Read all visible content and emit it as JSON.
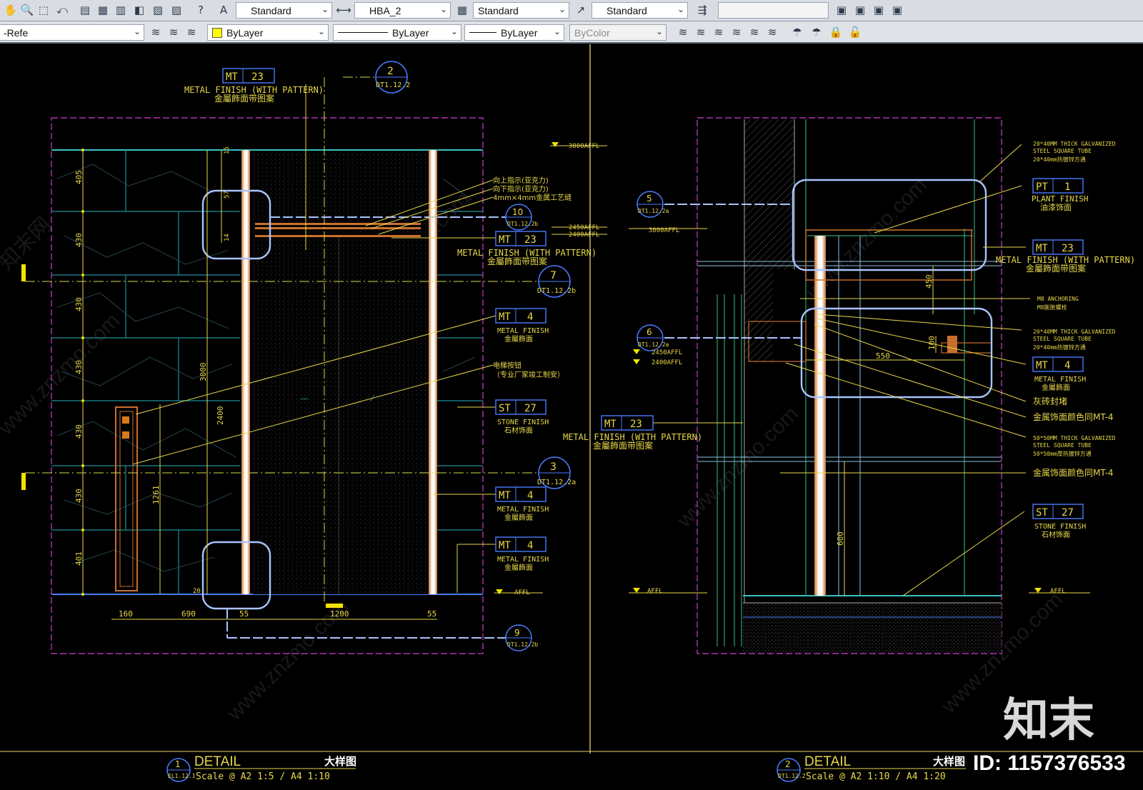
{
  "toolbar1": {
    "icons": [
      "pan-icon",
      "zoom-realtime-icon",
      "zoom-window-icon",
      "zoom-previous-icon",
      "save-icon",
      "properties-icon",
      "design-center-icon",
      "tool-palettes-icon",
      "sheet-set-icon",
      "markup-icon",
      "calculator-icon",
      "help-icon",
      "text-style-icon",
      "dim-style-icon",
      "table-style-icon",
      "multileader-style-icon",
      "layer-tools-icon",
      "view-add-icon",
      "view-2-icon",
      "view-3-icon",
      "view-4-icon"
    ],
    "text_style": "Standard",
    "dim_style": "HBA_2",
    "table_style": "Standard",
    "mleader_style": "Standard",
    "blank_field": ""
  },
  "toolbar2": {
    "layer_name": "-Refe",
    "color": "ByLayer",
    "linetype": "ByLayer",
    "lineweight": "ByLayer",
    "plotstyle": "ByColor",
    "color_hex": "#ffff00"
  },
  "drawing": {
    "left": {
      "tag_mt23_a": {
        "code": "MT",
        "num": "23",
        "en": "METAL FINISH (WITH PATTERN)",
        "cn": "金屬飾面带图案"
      },
      "callout_2": {
        "num": "2",
        "ref": "DT1.12.2"
      },
      "level_3000": "3000AFFL",
      "notes_top": [
        "向上指示(亚克力)",
        "向下指示(亚克力)",
        "4mm×4mm金属工艺缝"
      ],
      "callout_10": {
        "num": "10",
        "ref": "DT1.12.2b"
      },
      "level_2450": "2450AFFL",
      "level_2400": "2400AFFL",
      "tag_mt23_b": {
        "code": "MT",
        "num": "23",
        "en": "METAL FINISH (WITH PATTERN)",
        "cn": "金屬飾面带图案"
      },
      "callout_7": {
        "num": "7",
        "ref": "DT1.12.2b"
      },
      "tag_mt4_a": {
        "code": "MT",
        "num": "4",
        "en": "METAL FINISH",
        "cn": "金屬飾面"
      },
      "note_btn": [
        "电梯按钮",
        "（专业厂家竣工制安）"
      ],
      "tag_st27": {
        "code": "ST",
        "num": "27",
        "en": "STONE FINISH",
        "cn": "石材饰面"
      },
      "callout_3": {
        "num": "3",
        "ref": "DT1.12.2a"
      },
      "tag_mt4_b": {
        "code": "MT",
        "num": "4",
        "en": "METAL FINISH",
        "cn": "金屬飾面"
      },
      "tag_mt4_c": {
        "code": "MT",
        "num": "4",
        "en": "METAL FINISH",
        "cn": "金屬飾面"
      },
      "level_affl": "AFFL",
      "callout_9": {
        "num": "9",
        "ref": "DT1.12.2b"
      },
      "dims_v": [
        "405",
        "430",
        "430",
        "430",
        "430",
        "430",
        "401"
      ],
      "dims_small": [
        "15",
        "57",
        "14"
      ],
      "dim_3000": "3000",
      "dim_2400": "2400",
      "dim_1261": "1261",
      "dims_h": [
        "160",
        "690",
        "55",
        "1200",
        "55"
      ],
      "dim_small_b": "20"
    },
    "right": {
      "callout_5": {
        "num": "5",
        "ref": "DT1.12.2a"
      },
      "level_3000": "3000AFFL",
      "note_tube1": [
        "20*40MM THICK GALVANIZED",
        "STEEL SQUARE TUBE",
        "20*40mm热镀锌方通"
      ],
      "tag_pt1": {
        "code": "PT",
        "num": "1",
        "en": "PLANT FINISH",
        "cn": "油漆饰面"
      },
      "tag_mt23": {
        "code": "MT",
        "num": "23",
        "en": "METAL FINISH (WITH PATTERN)",
        "cn": "金屬飾面带图案"
      },
      "note_m8": [
        "M8 ANCHORING",
        "M8膨胀螺栓"
      ],
      "callout_6": {
        "num": "6",
        "ref": "DT1.12.2a"
      },
      "level_2450": "2450AFFL",
      "level_2400": "2400AFFL",
      "dim_450": "450",
      "dim_100": "100",
      "dim_550": "550",
      "note_tube2": [
        "20*40MM THICK GALVANIZED",
        "STEEL SQUARE TUBE",
        "20*40mm热镀锌方通"
      ],
      "tag_mt4": {
        "code": "MT",
        "num": "4",
        "en": "METAL FINISH",
        "cn": "金屬飾面"
      },
      "note_grey": "灰砖封堵",
      "note_mt4a": "金属饰面颜色同MT-4",
      "tag_mt23_b": {
        "code": "MT",
        "num": "23",
        "en": "METAL FINISH (WITH PATTERN)",
        "cn": "金屬飾面带图案"
      },
      "note_tube3": [
        "50*50MM THICK GALVANIZED",
        "STEEL SQUARE TUBE",
        "50*50mm厚热镀锌方通"
      ],
      "note_mt4b": "金属饰面颜色同MT-4",
      "tag_st27": {
        "code": "ST",
        "num": "27",
        "en": "STONE FINISH",
        "cn": "石材饰面"
      },
      "dim_600": "600",
      "level_affl_l": "AFFL",
      "level_affl_r": "AFFL"
    },
    "title1": {
      "num": "1",
      "ref": "EL1.12.1",
      "word": "DETAIL",
      "cn": "大样图",
      "scale": "Scale @ A2 1:5 / A4 1:10"
    },
    "title2": {
      "num": "2",
      "ref": "DT1.12.2",
      "word": "DETAIL",
      "cn": "大样图",
      "scale": "Scale @ A2 1:10 / A4 1:20"
    },
    "watermark": "www.znzmo.com",
    "watermark_cn": "知末网",
    "logo": "知末",
    "id_text": "ID: 1157376533"
  }
}
